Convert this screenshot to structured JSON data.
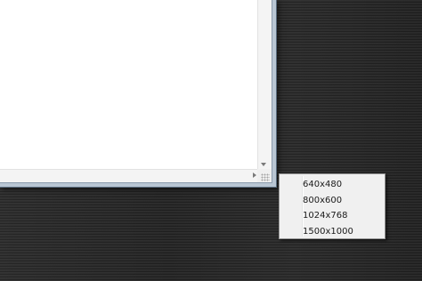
{
  "context_menu": {
    "items": [
      {
        "label": "640x480"
      },
      {
        "label": "800x600"
      },
      {
        "label": "1024x768"
      },
      {
        "label": "1500x1000"
      }
    ]
  },
  "icons": {
    "scroll_down": "chevron-down-icon",
    "scroll_right": "chevron-right-icon",
    "size_grip": "resize-grip-icon"
  },
  "colors": {
    "desktop_background": "#2b2b2b",
    "window_frame": "#b9c6d3",
    "menu_background": "#f0f0f0",
    "menu_border": "#979797"
  }
}
